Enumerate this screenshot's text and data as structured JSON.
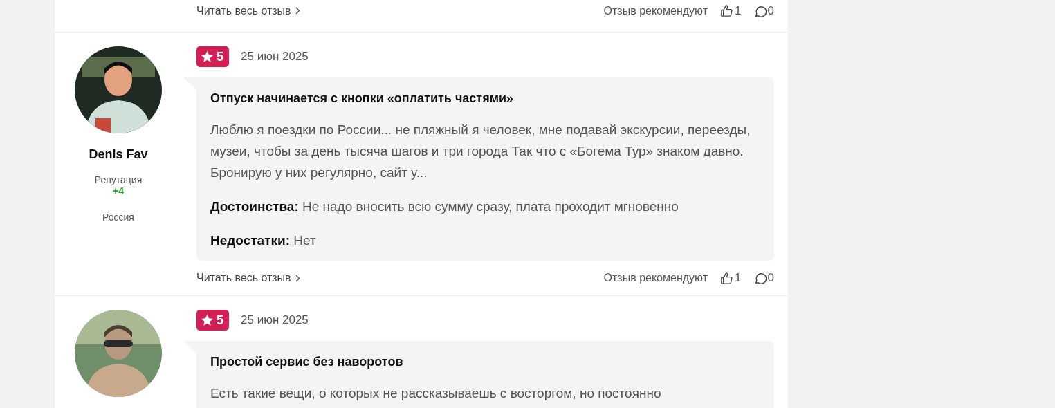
{
  "reviews": [
    {
      "footer": {
        "read_more": "Читать весь отзыв",
        "recommend_label": "Отзыв рекомендуют",
        "likes": "1",
        "comments": "0"
      }
    },
    {
      "author": {
        "name": "Denis Fav",
        "reputation_label": "Репутация",
        "reputation": "+4",
        "country": "Россия"
      },
      "rating": "5",
      "date": "25 июн 2025",
      "title": "Отпуск начинается с кнопки «оплатить частями»",
      "text": "Люблю я поездки по России... не пляжный я человек, мне подавай экскурсии, переезды, музеи, чтобы за день тысяча шагов и три города Так что с «Богема Тур» знаком давно. Бронирую у них регулярно, сайт у...",
      "pros_label": "Достоинства:",
      "pros": "Не надо вносить всю сумму сразу, плата проходит мгновенно",
      "cons_label": "Недостатки:",
      "cons": "Нет",
      "footer": {
        "read_more": "Читать весь отзыв",
        "recommend_label": "Отзыв рекомендуют",
        "likes": "1",
        "comments": "0"
      }
    },
    {
      "rating": "5",
      "date": "25 июн 2025",
      "title": "Простой сервис без наворотов",
      "text": "Есть такие вещи, о которых не рассказываешь с восторгом, но постоянно"
    }
  ]
}
